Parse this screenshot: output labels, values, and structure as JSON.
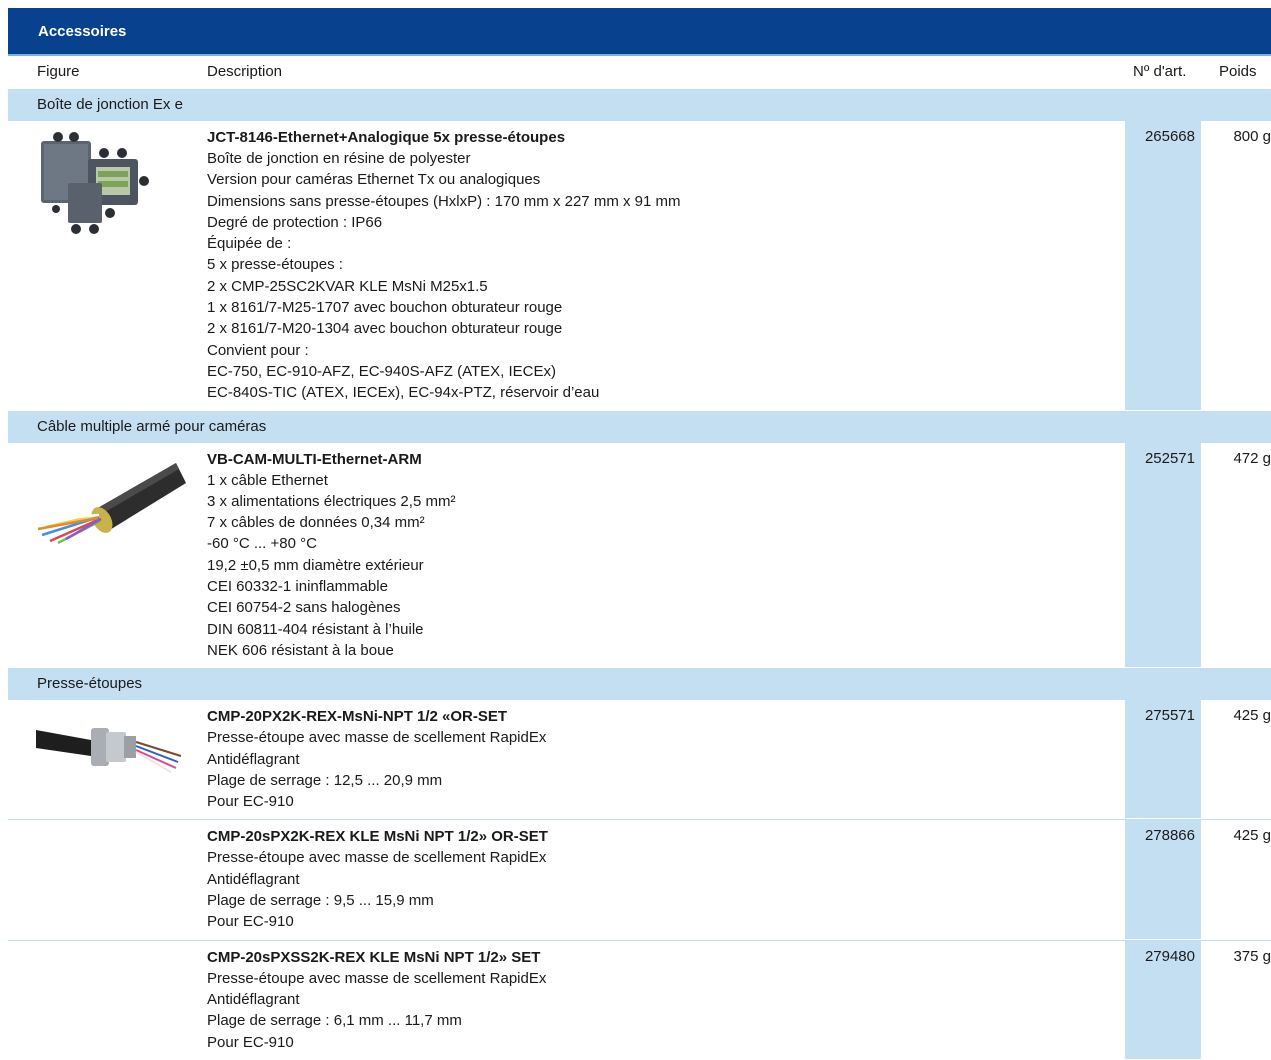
{
  "header": {
    "title": "Accessoires"
  },
  "columns": {
    "figure": "Figure",
    "description": "Description",
    "article": "Nº d'art.",
    "weight": "Poids"
  },
  "groups": [
    {
      "label": "Boîte de jonction Ex e",
      "image": "junction-box-image",
      "items": [
        {
          "name": "JCT-8146-Ethernet+Analogique 5x presse-étoupes",
          "lines": [
            "Boîte de jonction en résine de polyester",
            "Version pour caméras Ethernet Tx ou analogiques",
            "Dimensions sans presse-étoupes (HxlxP) : 170 mm x 227 mm x 91 mm",
            "Degré de protection : IP66",
            "Équipée de :",
            "5 x presse-étoupes :",
            "2 x CMP-25SC2KVAR KLE MsNi M25x1.5",
            "1 x 8161/7-M25-1707 avec bouchon obturateur rouge",
            "2 x 8161/7-M20-1304 avec bouchon obturateur rouge",
            "Convient pour :",
            "EC-750, EC-910-AFZ, EC-940S-AFZ (ATEX, IECEx)",
            "EC-840S-TIC (ATEX, IECEx), EC-94x-PTZ, réservoir d’eau"
          ],
          "article": "265668",
          "weight": "800 g"
        }
      ]
    },
    {
      "label": "Câble multiple armé pour caméras",
      "image": "armored-cable-image",
      "items": [
        {
          "name": "VB-CAM-MULTI-Ethernet-ARM",
          "lines": [
            "1 x câble Ethernet",
            "3 x alimentations électriques 2,5 mm²",
            "7 x câbles de données 0,34 mm²",
            "-60 °C ... +80 °C",
            "19,2 ±0,5 mm diamètre extérieur",
            "CEI 60332-1 ininflammable",
            "CEI 60754-2 sans halogènes",
            "DIN 60811-404 résistant à l’huile",
            "NEK 606 résistant à la boue"
          ],
          "article": "252571",
          "weight": "472 g"
        }
      ]
    },
    {
      "label": "Presse-étoupes",
      "image": "cable-gland-image",
      "items": [
        {
          "name": "CMP-20PX2K-REX-MsNi-NPT 1/2 «OR-SET",
          "lines": [
            "Presse-étoupe avec masse de scellement RapidEx",
            "Antidéflagrant",
            "Plage de serrage : 12,5 ... 20,9 mm",
            "Pour EC-910"
          ],
          "article": "275571",
          "weight": "425 g"
        },
        {
          "name": "CMP-20sPX2K-REX KLE MsNi NPT 1/2» OR-SET",
          "lines": [
            "Presse-étoupe avec masse de scellement RapidEx",
            "Antidéflagrant",
            "Plage de serrage : 9,5 ... 15,9 mm",
            "Pour EC-910"
          ],
          "article": "278866",
          "weight": "425 g"
        },
        {
          "name": "CMP-20sPXSS2K-REX KLE MsNi NPT 1/2» SET",
          "lines": [
            "Presse-étoupe avec masse de scellement RapidEx",
            "Antidéflagrant",
            "Plage de serrage : 6,1 mm ... 11,7 mm",
            "Pour EC-910"
          ],
          "article": "279480",
          "weight": "375 g"
        }
      ]
    }
  ],
  "colors": {
    "header_bg": "#08418d",
    "band_bg": "#c5dff2"
  }
}
